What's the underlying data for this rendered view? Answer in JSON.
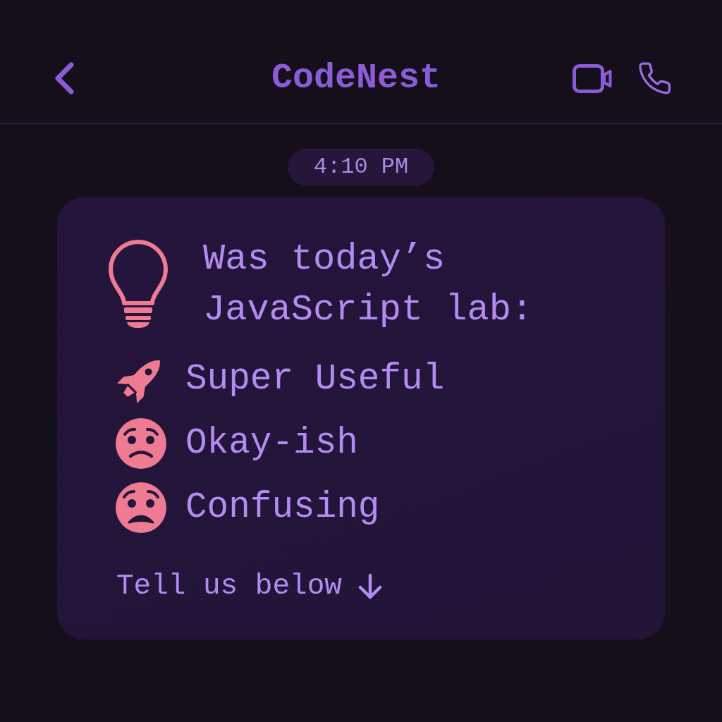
{
  "header": {
    "title": "CodeNest"
  },
  "timestamp": "4:10 PM",
  "message": {
    "question": "Was today’s JavaScript lab:",
    "options": [
      {
        "kind": "rocket",
        "label": "Super Useful"
      },
      {
        "kind": "uneasy",
        "label": "Okay-ish"
      },
      {
        "kind": "sad",
        "label": "Confusing"
      }
    ],
    "footer": "Tell us below"
  }
}
